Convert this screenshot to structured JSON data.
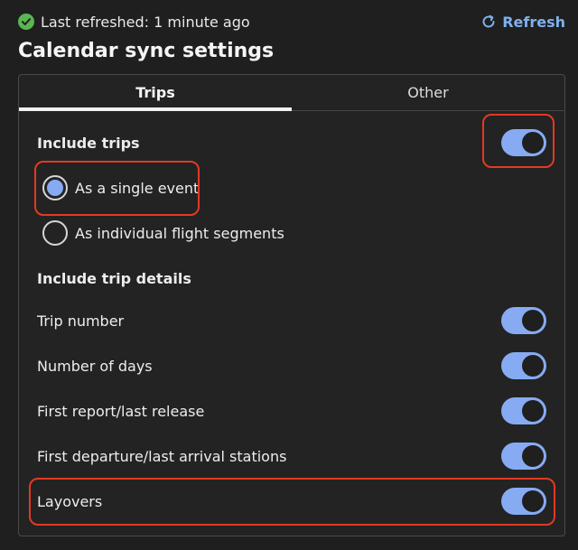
{
  "header": {
    "status_text": "Last refreshed: 1 minute ago",
    "refresh_label": "Refresh",
    "title": "Calendar sync settings"
  },
  "tabs": [
    {
      "label": "Trips",
      "active": true
    },
    {
      "label": "Other",
      "active": false
    }
  ],
  "trips": {
    "include_trips_label": "Include trips",
    "include_trips_on": true,
    "radio_options": [
      {
        "label": "As a single event",
        "selected": true
      },
      {
        "label": "As individual flight segments",
        "selected": false
      }
    ],
    "details_heading": "Include trip details",
    "details": [
      {
        "label": "Trip number",
        "on": true
      },
      {
        "label": "Number of days",
        "on": true
      },
      {
        "label": "First report/last release",
        "on": true
      },
      {
        "label": "First departure/last arrival stations",
        "on": true
      },
      {
        "label": "Layovers",
        "on": true
      }
    ]
  },
  "colors": {
    "accent": "#87abf3",
    "link": "#7fb0ef",
    "success": "#5ab552",
    "highlight": "#e23a22",
    "background": "#1f1f1f"
  }
}
